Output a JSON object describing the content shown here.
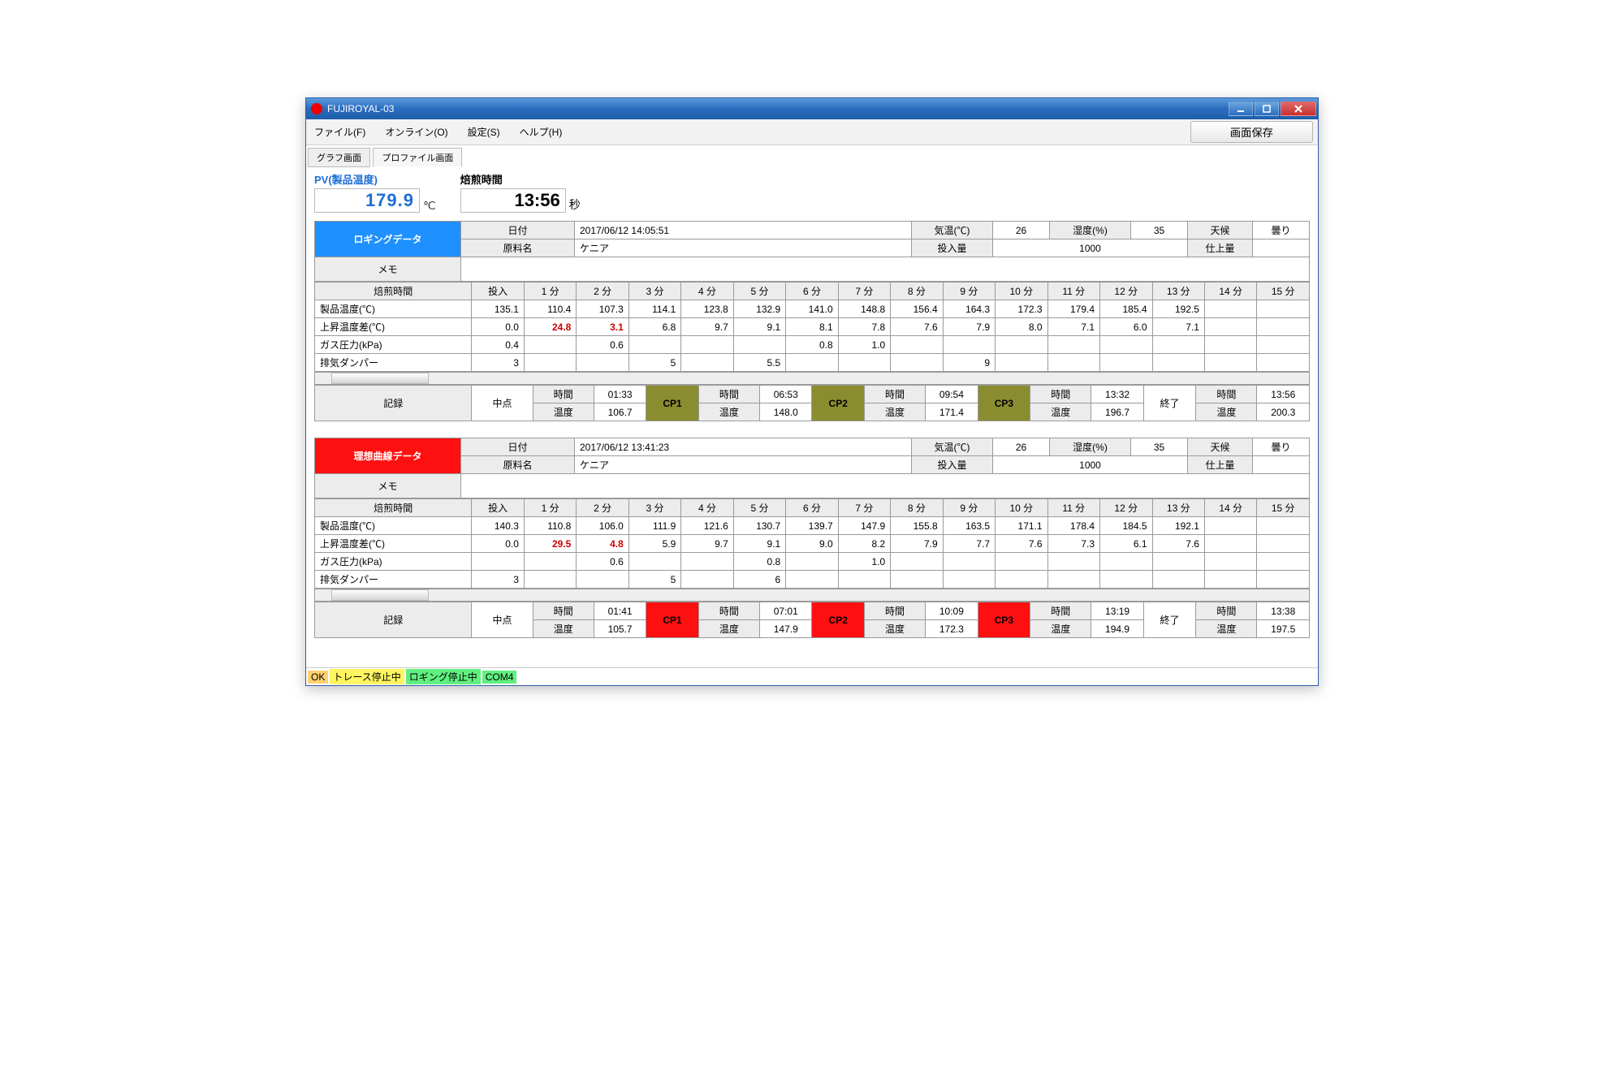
{
  "window": {
    "title": "FUJIROYAL-03"
  },
  "menu": {
    "file": "ファイル(F)",
    "online": "オンライン(O)",
    "settings": "設定(S)",
    "help": "ヘルプ(H)",
    "save_screen": "画面保存"
  },
  "tabs": {
    "graph": "グラフ画面",
    "profile": "プロファイル画面"
  },
  "pv": {
    "label": "PV(製品温度)",
    "value": "179.9",
    "unit": "℃"
  },
  "roast_time": {
    "label": "焙煎時間",
    "value": "13:56",
    "unit": "秒"
  },
  "hdr": {
    "date": "日付",
    "material": "原料名",
    "temp": "気温(℃)",
    "humidity": "湿度(%)",
    "weather": "天候",
    "input_amount": "投入量",
    "finish_amount": "仕上量",
    "memo": "メモ",
    "roast_time": "焙煎時間",
    "row_product": "製品温度(℃)",
    "row_rise": "上昇温度差(℃)",
    "row_gas": "ガス圧力(kPa)",
    "row_damper": "排気ダンパー",
    "record": "記録",
    "midpoint": "中点",
    "time": "時間",
    "temp2": "温度",
    "end": "終了",
    "input": "投入",
    "minutes": [
      "1 分",
      "2 分",
      "3 分",
      "4 分",
      "5 分",
      "6 分",
      "7 分",
      "8 分",
      "9 分",
      "10 分",
      "11 分",
      "12 分",
      "13 分",
      "14 分",
      "15 分"
    ]
  },
  "logging": {
    "title": "ロギングデータ",
    "date": "2017/06/12 14:05:51",
    "material": "ケニア",
    "temp": "26",
    "humidity": "35",
    "weather": "曇り",
    "input_amount": "1000",
    "finish_amount": "",
    "product": [
      "135.1",
      "110.4",
      "107.3",
      "114.1",
      "123.8",
      "132.9",
      "141.0",
      "148.8",
      "156.4",
      "164.3",
      "172.3",
      "179.4",
      "185.4",
      "192.5",
      "",
      ""
    ],
    "rise": [
      "0.0",
      "24.8",
      "3.1",
      "6.8",
      "9.7",
      "9.1",
      "8.1",
      "7.8",
      "7.6",
      "7.9",
      "8.0",
      "7.1",
      "6.0",
      "7.1",
      "",
      ""
    ],
    "rise_red": [
      false,
      true,
      true,
      false,
      false,
      false,
      false,
      false,
      false,
      false,
      false,
      false,
      false,
      false,
      false,
      false
    ],
    "gas": [
      "0.4",
      "",
      "0.6",
      "",
      "",
      "",
      "0.8",
      "1.0",
      "",
      "",
      "",
      "",
      "",
      "",
      "",
      ""
    ],
    "damper": [
      "3",
      "",
      "",
      "5",
      "",
      "5.5",
      "",
      "",
      "",
      "9",
      "",
      "",
      "",
      "",
      "",
      ""
    ],
    "cp": {
      "cp1": {
        "label": "CP1",
        "time": "01:33",
        "temp": "106.7"
      },
      "cp2": {
        "label": "CP2",
        "time": "06:53",
        "temp": "148.0"
      },
      "cp3": {
        "label": "CP3",
        "time": "09:54",
        "temp": "171.4"
      },
      "cp4": {
        "time": "13:32",
        "temp": "196.7"
      },
      "end": {
        "time": "13:56",
        "temp": "200.3"
      }
    }
  },
  "ideal": {
    "title": "理想曲線データ",
    "date": "2017/06/12 13:41:23",
    "material": "ケニア",
    "temp": "26",
    "humidity": "35",
    "weather": "曇り",
    "input_amount": "1000",
    "finish_amount": "",
    "product": [
      "140.3",
      "110.8",
      "106.0",
      "111.9",
      "121.6",
      "130.7",
      "139.7",
      "147.9",
      "155.8",
      "163.5",
      "171.1",
      "178.4",
      "184.5",
      "192.1",
      "",
      ""
    ],
    "rise": [
      "0.0",
      "29.5",
      "4.8",
      "5.9",
      "9.7",
      "9.1",
      "9.0",
      "8.2",
      "7.9",
      "7.7",
      "7.6",
      "7.3",
      "6.1",
      "7.6",
      "",
      ""
    ],
    "rise_red": [
      false,
      true,
      true,
      false,
      false,
      false,
      false,
      false,
      false,
      false,
      false,
      false,
      false,
      false,
      false,
      false
    ],
    "gas": [
      "",
      "",
      "0.6",
      "",
      "",
      "0.8",
      "",
      "1.0",
      "",
      "",
      "",
      "",
      "",
      "",
      "",
      ""
    ],
    "damper": [
      "3",
      "",
      "",
      "5",
      "",
      "6",
      "",
      "",
      "",
      "",
      "",
      "",
      "",
      "",
      "",
      ""
    ],
    "cp": {
      "cp1": {
        "label": "CP1",
        "time": "01:41",
        "temp": "105.7"
      },
      "cp2": {
        "label": "CP2",
        "time": "07:01",
        "temp": "147.9"
      },
      "cp3": {
        "label": "CP3",
        "time": "10:09",
        "temp": "172.3"
      },
      "cp4": {
        "time": "13:19",
        "temp": "194.9"
      },
      "end": {
        "time": "13:38",
        "temp": "197.5"
      }
    }
  },
  "status": {
    "ok": "OK",
    "trace": "トレース停止中",
    "log": "ロギング停止中",
    "com": "COM4"
  }
}
